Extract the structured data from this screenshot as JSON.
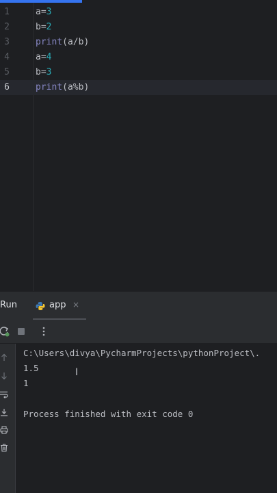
{
  "editor": {
    "lines": [
      {
        "num": "1",
        "parts": [
          {
            "t": "a=",
            "c": "plain"
          },
          {
            "t": "3",
            "c": "num"
          }
        ]
      },
      {
        "num": "2",
        "parts": [
          {
            "t": "b=",
            "c": "plain"
          },
          {
            "t": "2",
            "c": "num"
          }
        ]
      },
      {
        "num": "3",
        "parts": [
          {
            "t": "print",
            "c": "fn"
          },
          {
            "t": "(a/b)",
            "c": "plain"
          }
        ]
      },
      {
        "num": "4",
        "parts": [
          {
            "t": "a=",
            "c": "plain"
          },
          {
            "t": "4",
            "c": "num"
          }
        ]
      },
      {
        "num": "5",
        "parts": [
          {
            "t": "b=",
            "c": "plain"
          },
          {
            "t": "3",
            "c": "num"
          }
        ]
      },
      {
        "num": "6",
        "parts": [
          {
            "t": "print",
            "c": "fn"
          },
          {
            "t": "(a%b)",
            "c": "plain"
          }
        ]
      }
    ],
    "current_line": "6"
  },
  "run_panel": {
    "title": "Run",
    "tab_label": "app",
    "tab_close": "×"
  },
  "console": {
    "command": "C:\\Users\\divya\\PycharmProjects\\pythonProject\\.",
    "output1": "1.5",
    "output2": "1",
    "exit_message": "Process finished with exit code 0"
  },
  "colors": {
    "accent": "#3574f0",
    "number": "#2aacb8",
    "builtin": "#8888c6",
    "text": "#bcbec4"
  },
  "icons": [
    "rerun-icon",
    "stop-icon",
    "more-options-icon",
    "python-icon",
    "scroll-up-icon",
    "scroll-down-icon",
    "soft-wrap-icon",
    "scroll-to-end-icon",
    "print-icon",
    "trash-icon"
  ]
}
